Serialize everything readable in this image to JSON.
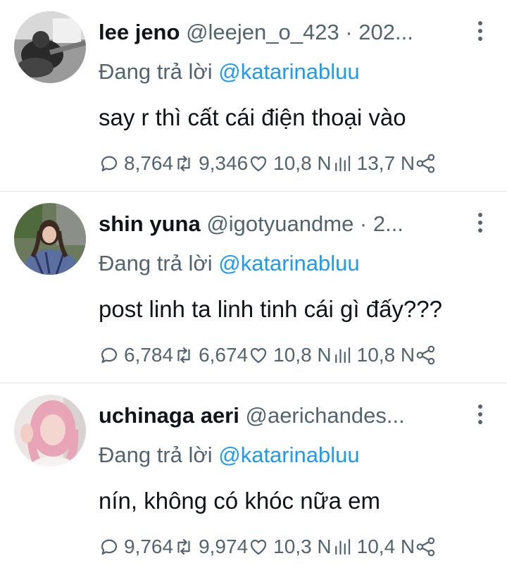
{
  "replies": [
    {
      "name": "lee jeno",
      "handle": "@leejen_o_423 · 202...",
      "replying_prefix": "Đang trả lời ",
      "replying_to": "@katarinabluu",
      "text": "say r thì cất cái điện thoại vào",
      "stats": {
        "replies": "8,764",
        "retweets": "9,346",
        "likes": "10,8 N",
        "views": "13,7 N"
      },
      "avatar_icon": "avatar-photo-guitar"
    },
    {
      "name": "shin yuna",
      "handle": "@igotyuandme · 2...",
      "replying_prefix": "Đang trả lời ",
      "replying_to": "@katarinabluu",
      "text": "post linh ta linh tinh cái gì đấy???",
      "stats": {
        "replies": "6,784",
        "retweets": "6,674",
        "likes": "10,8 N",
        "views": "10,8 N"
      },
      "avatar_icon": "avatar-photo-girl"
    },
    {
      "name": "uchinaga aeri",
      "handle": "@aerichandes...",
      "replying_prefix": "Đang trả lời ",
      "replying_to": "@katarinabluu",
      "text": "nín, không có khóc nữa em",
      "stats": {
        "replies": "9,764",
        "retweets": "9,974",
        "likes": "10,3 N",
        "views": "10,4 N"
      },
      "avatar_icon": "avatar-photo-pink-hair"
    }
  ],
  "colors": {
    "link": "#1d9bf0",
    "muted": "#536471",
    "text": "#0f1419",
    "divider": "#e3e6ea"
  }
}
